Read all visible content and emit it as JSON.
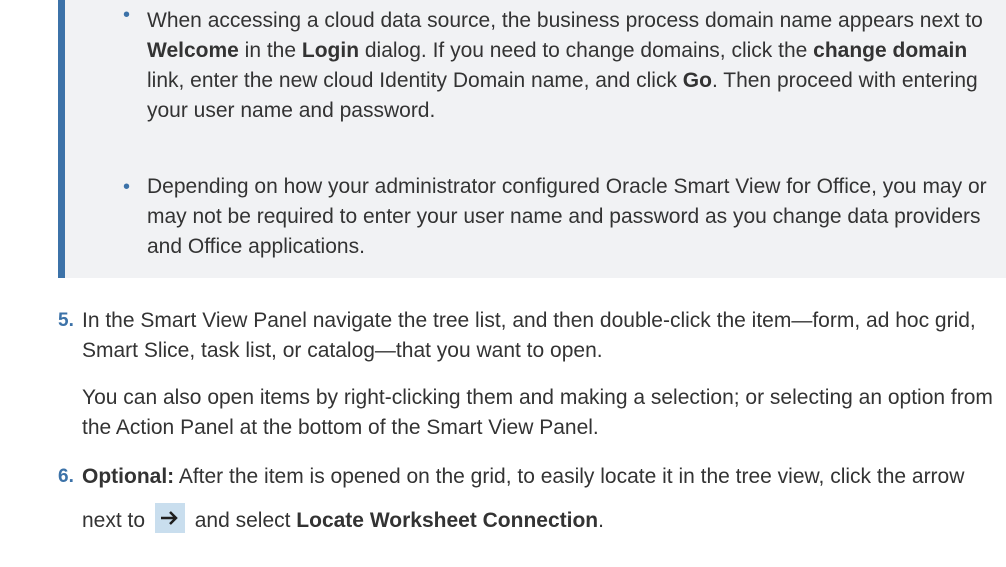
{
  "note": {
    "bullets": [
      {
        "parts": [
          {
            "t": "When accessing a cloud data source, the business process domain name appears next to ",
            "b": false
          },
          {
            "t": "Welcome",
            "b": true
          },
          {
            "t": " in the ",
            "b": false
          },
          {
            "t": "Login",
            "b": true
          },
          {
            "t": " dialog. If you need to change domains, click the ",
            "b": false
          },
          {
            "t": "change domain",
            "b": true
          },
          {
            "t": " link, enter the new cloud Identity Domain name, and click ",
            "b": false
          },
          {
            "t": "Go",
            "b": true
          },
          {
            "t": ". Then proceed with entering your user name and password.",
            "b": false
          }
        ]
      },
      {
        "parts": [
          {
            "t": "Depending on how your administrator configured Oracle Smart View for Office, you may or may not be required to enter your user name and password as you change data providers and Office applications.",
            "b": false
          }
        ]
      }
    ]
  },
  "steps": {
    "step5": {
      "number": "5.",
      "text": "In the Smart View Panel navigate the tree list, and then double-click the item—form, ad hoc grid, Smart Slice, task list, or catalog—that you want to open.",
      "followup": "You can also open items by right-clicking them and making a selection; or selecting an option from the Action Panel at the bottom of the Smart View Panel."
    },
    "step6": {
      "number": "6.",
      "optional_label": "Optional:",
      "text_before": " After the item is opened on the grid, to easily locate it in the tree view, click the arrow next to ",
      "text_mid": " and select ",
      "action_label": "Locate Worksheet Connection",
      "text_after": "."
    }
  },
  "icons": {
    "arrow": "right-arrow-icon"
  },
  "colors": {
    "accent": "#3c72a8",
    "note_bg": "#f1f2f4",
    "icon_bg": "#c9deee",
    "text": "#333333"
  }
}
